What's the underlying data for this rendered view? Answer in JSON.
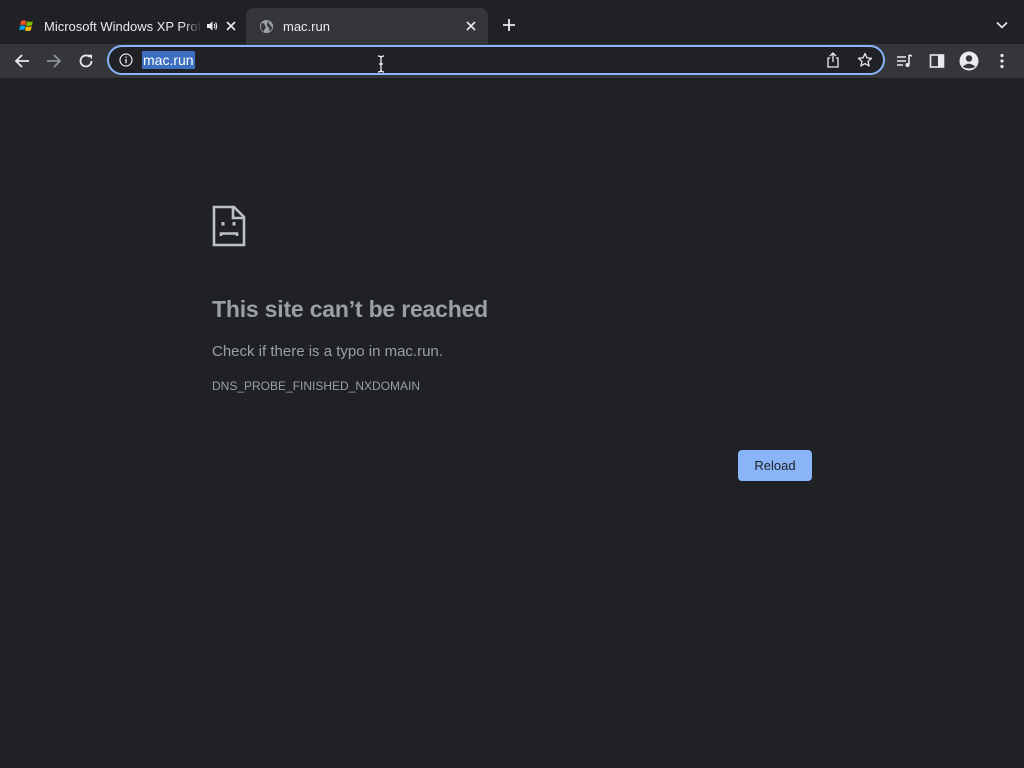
{
  "colors": {
    "background": "#202124",
    "toolbar": "#35363a",
    "accent": "#8ab4f8",
    "selection": "#3c6fbf",
    "muted_text": "#9aa0a6"
  },
  "tabs": [
    {
      "title": "Microsoft Windows XP Professional",
      "favicon": "windows-xp-logo-icon",
      "audio": "speaker-icon",
      "active": false
    },
    {
      "title": "mac.run",
      "favicon": "globe-icon",
      "active": true
    }
  ],
  "toolbar": {
    "back_icon": "arrow-left-icon",
    "forward_icon": "arrow-right-icon",
    "reload_icon": "refresh-icon",
    "omnibox": {
      "info_icon": "info-icon",
      "url": "mac.run",
      "share_icon": "share-icon",
      "bookmark_icon": "star-icon"
    },
    "right_icons": [
      "reading-list-icon",
      "side-panel-icon",
      "profile-icon",
      "more-vert-icon"
    ]
  },
  "error": {
    "icon": "sad-page-icon",
    "title": "This site can’t be reached",
    "suggestion": "Check if there is a typo in mac.run.",
    "code": "DNS_PROBE_FINISHED_NXDOMAIN",
    "reload_label": "Reload"
  }
}
